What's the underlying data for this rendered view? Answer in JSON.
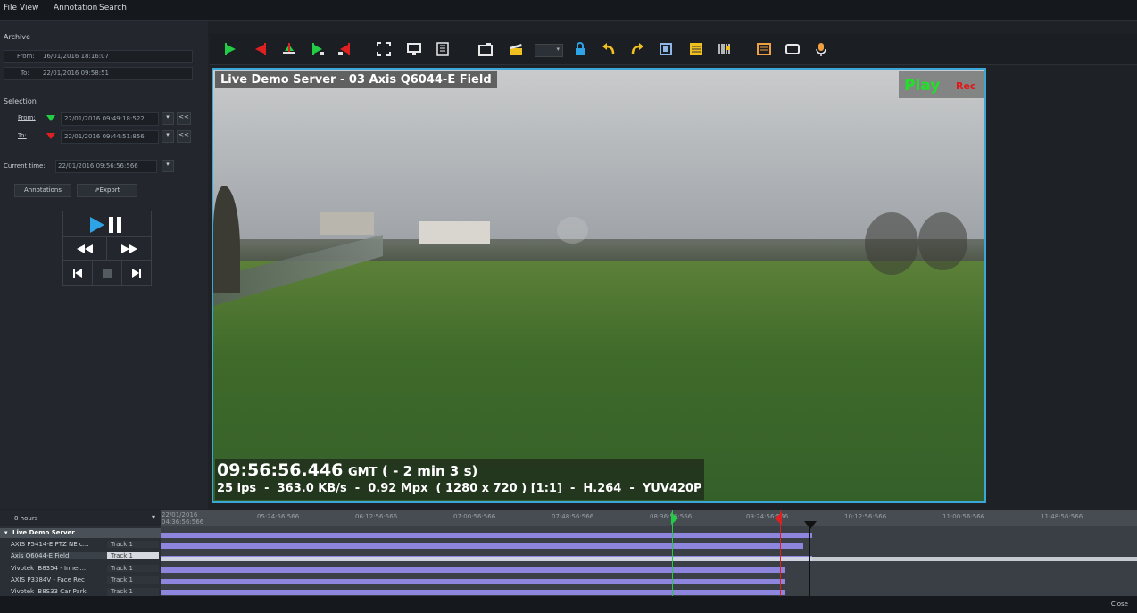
{
  "menu": [
    "File",
    "View",
    "Annotation",
    "Search"
  ],
  "archive": {
    "title": "Archive",
    "from_label": "From:",
    "from_value": "16/01/2016 18:16:07",
    "to_label": "To:",
    "to_value": "22/01/2016 09:58:51"
  },
  "selection": {
    "title": "Selection",
    "from_label": "From:",
    "from_value": "22/01/2016 09:49:18:522",
    "to_label": "To:",
    "to_value": "22/01/2016 09:44:51:856",
    "collapse": "<<"
  },
  "current_time": {
    "label": "Current time:",
    "value": "22/01/2016 09:56:56:566"
  },
  "buttons": {
    "annotations": "Annotations",
    "export": "Export"
  },
  "video": {
    "title": "Live Demo Server - 03 Axis Q6044-E Field",
    "play": "Play",
    "rec": "Rec",
    "time_big": "09:56:56.446",
    "time_tz": "GMT",
    "time_offset": "( - 2 min 3 s)",
    "info": "25 ips  -  363.0 KB/s  -  0.92 Mpx  ( 1280 x 720 ) [1:1]  -  H.264  -  YUV420P"
  },
  "timeline": {
    "range": "8 hours",
    "first_date": "22/01/2016",
    "first_time": "04:36:56:566",
    "ticks": [
      "05:24:56:566",
      "06:12:56:566",
      "07:00:56:566",
      "07:48:56:566",
      "08:36:56:566",
      "09:24:56:566",
      "10:12:56:566",
      "11:00:56:566",
      "11:48:56:566"
    ],
    "server": "Live Demo Server",
    "rows": [
      {
        "name": "AXIS P5414-E PTZ NE c...",
        "track": "Track 1"
      },
      {
        "name": "Axis Q6044-E Field",
        "track": "Track 1"
      },
      {
        "name": "Vivotek IB8354 - Inner...",
        "track": "Track 1"
      },
      {
        "name": "AXIS P3384V - Face Rec",
        "track": "Track 1"
      },
      {
        "name": "Vivotek IB8S33 Car Park",
        "track": "Track 1"
      }
    ]
  },
  "status": {
    "close": "Close"
  },
  "colors": {
    "accent": "#3aa7d6",
    "play": "#22e02a",
    "rec": "#e01818",
    "bars": "#8e86de",
    "green_marker": "#22cc44",
    "red_marker": "#e02020"
  }
}
